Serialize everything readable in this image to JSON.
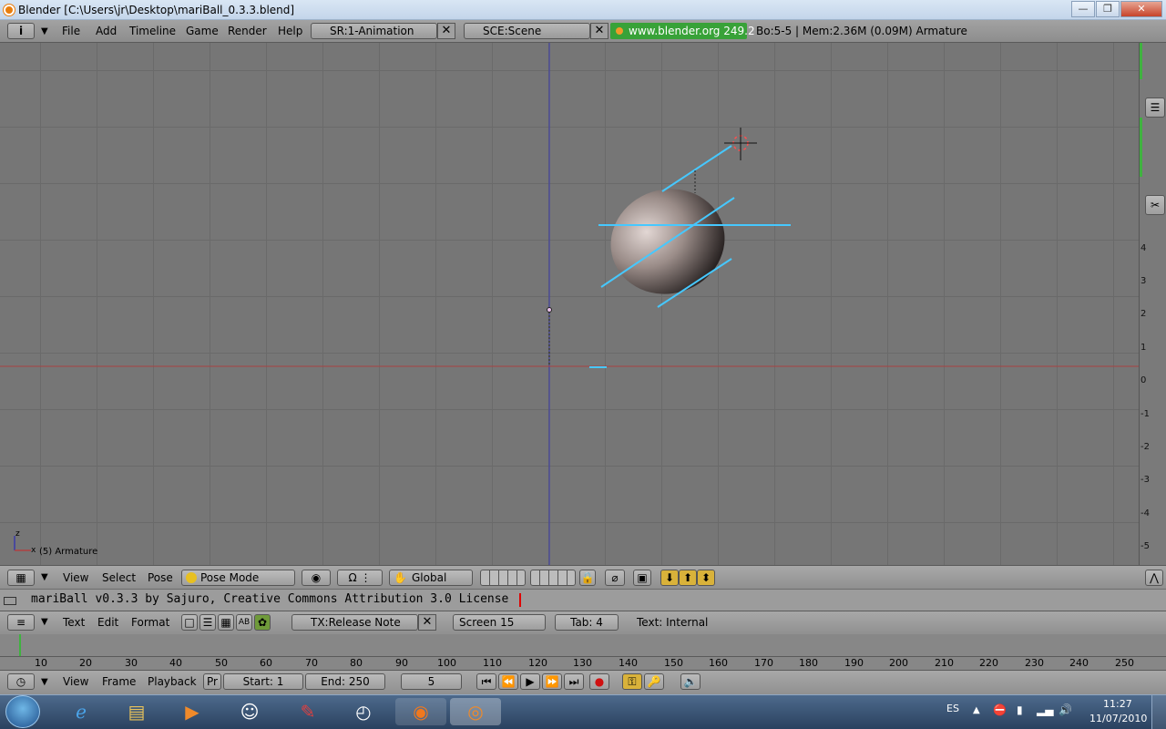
{
  "window": {
    "title": "Blender [C:\\Users\\jr\\Desktop\\mariBall_0.3.3.blend]",
    "minimize": "—",
    "maximize": "❐",
    "close": "✕"
  },
  "header": {
    "info_icon": "i",
    "menus": [
      "File",
      "Add",
      "Timeline",
      "Game",
      "Render",
      "Help"
    ],
    "screen_field": "SR:1-Animation",
    "scene_field": "SCE:Scene",
    "version_badge": "www.blender.org 249.2",
    "status": "Bo:5-5  | Mem:2.36M (0.09M) Armature",
    "accent_color": "#38a238"
  },
  "viewport": {
    "object_label": "(5) Armature",
    "axis_z": "z",
    "axis_x": "x",
    "ruler": [
      "4",
      "3",
      "2",
      "1",
      "0",
      "-1",
      "-2",
      "-3",
      "-4",
      "-5"
    ]
  },
  "view3d_header": {
    "menus": [
      "View",
      "Select",
      "Pose"
    ],
    "mode": "Pose Mode",
    "orientation": "Global"
  },
  "text_editor": {
    "line": "mariBall v0.3.3 by Sajuro, Creative Commons Attribution 3.0 License",
    "menus": [
      "Text",
      "Edit",
      "Format"
    ],
    "text_block": "TX:Release Note",
    "font": "Screen 15",
    "tab": "Tab: 4",
    "status": "Text: Internal"
  },
  "timeline": {
    "ticks": [
      "10",
      "20",
      "30",
      "40",
      "50",
      "60",
      "70",
      "80",
      "90",
      "100",
      "110",
      "120",
      "130",
      "140",
      "150",
      "160",
      "170",
      "180",
      "190",
      "200",
      "210",
      "220",
      "230",
      "240",
      "250"
    ],
    "menus": [
      "View",
      "Frame",
      "Playback"
    ],
    "pr": "Pr",
    "start": "Start: 1",
    "end": "End: 250",
    "current_frame": "5"
  },
  "taskbar": {
    "language": "ES",
    "time": "11:27",
    "date": "11/07/2010"
  }
}
